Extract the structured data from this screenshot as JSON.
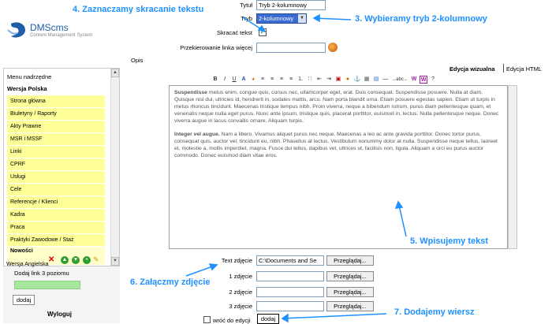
{
  "app": {
    "logo_name": "DMScms",
    "logo_tagline": "Content Management System"
  },
  "sidebar": {
    "menu_parent_label": "Menu nadrzędne",
    "version_label": "Wersja Polska",
    "items": [
      {
        "label": "Strona główna"
      },
      {
        "label": "Biuletyny / Raporty"
      },
      {
        "label": "Akty Prawne"
      },
      {
        "label": "MSR i MSSF"
      },
      {
        "label": "Linki"
      },
      {
        "label": "CPRF"
      },
      {
        "label": "Usługi"
      },
      {
        "label": "Cele"
      },
      {
        "label": "Referencje / Klienci"
      },
      {
        "label": "Kadra"
      },
      {
        "label": "Praca"
      },
      {
        "label": "Praktyki Zawodowe / Staż"
      },
      {
        "label": "Nowości"
      }
    ],
    "version_en_label": "Wersja Angielska",
    "add_link_label": "Dodaj link 3 poziomu",
    "add_button": "dodaj",
    "logout": "Wyloguj"
  },
  "form": {
    "title_label": "Tytuł",
    "title_value": "Tryb 2-kolumnowy",
    "mode_label": "Tryb",
    "mode_value": "2-kolumnowy",
    "shorten_label": "Skracać tekst",
    "redirect_label": "Przekierowanie linka więcej",
    "description_label": "Opis",
    "tab_visual": "Edycja wizualna",
    "tab_html": "Edycja HTML",
    "editor_para1_bold": "Suspendisse",
    "editor_para1": " metus enim, congue quis, cursus nec, ullamcorper eget, erat. Duis consequat. Suspendisse posuere. Nulla at diam. Quisque nisl dui, ultricies id, hendrerit in, sodales mattis, arcu. Nam porta blandit urna. Etiam posuere egestas sapien. Etiam ut turpis in metus rhoncus tincidunt. Maecenas tristique tempus nibh. Proin viverra, neque a bibendum rutrum, purus diam pellentesque quam, et venenatis neque nulla eget purus. Nunc ante ipsum, tristique quis, placerat porttitor, euismod in, lectus. Nulla pellentesque neque. Donec viverra augue in lacus convallis ornare. Aliquam turpis.",
    "editor_para2_bold": "Integer vel augue.",
    "editor_para2": " Nam a libero. Vivamus aliquet purus nec neque. Maecenas a leo ac ante gravida porttitor. Donec tortor purus, consequat quis, auctor vel, tincidunt eu, nibh. Phasellus at lectus. Vestibulum nonummy dolor at nulla. Suspendisse neque tellus, laoreet et, molestie a, mollis imperdiet, magna. Fusce dui tellus, dapibus vel, ultrices ut, facilisis non, ligula. Aliquam a orci eu purus auctor commodo. Donec euismod diam vitae eros.",
    "photo_text_label": "Text zdjęcie",
    "photo_text_value": "C:\\Documents and Se",
    "photo1_label": "1 zdjęcie",
    "photo2_label": "2 zdjęcie",
    "photo3_label": "3 zdjęcie",
    "browse": "Przeglądaj...",
    "return_label": "wróć do edycji",
    "row_button": "dodaj"
  },
  "annotations": {
    "a3": "3. Wybieramy tryb 2-kolumnowy",
    "a4": "4. Zaznaczamy skracanie tekstu",
    "a5": "5. Wpisujemy tekst",
    "a6": "6. Załączmy zdjęcie",
    "a7": "7. Dodajemy wiersz"
  },
  "colors": {
    "accent": "#1e90ff",
    "menu_yellow": "#ffff99"
  }
}
